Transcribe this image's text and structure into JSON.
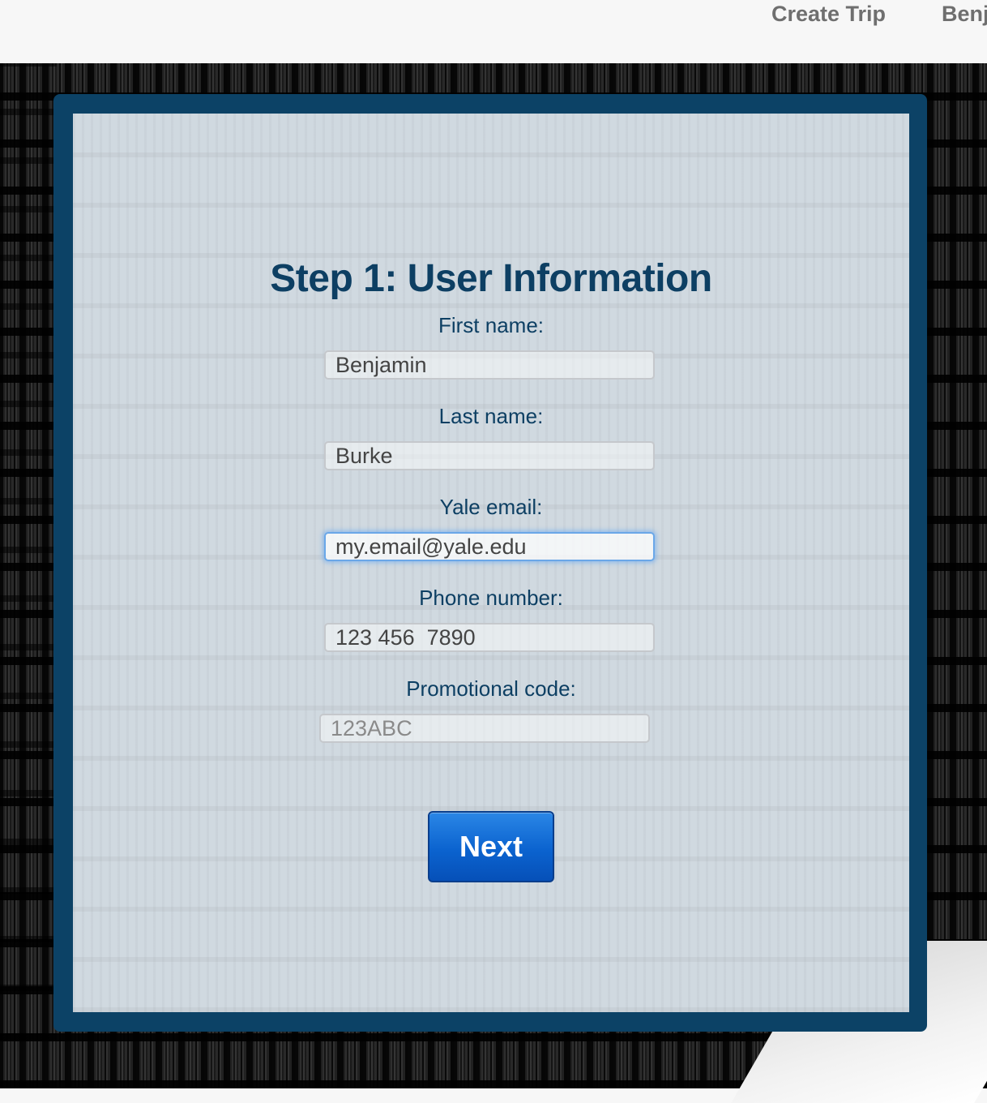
{
  "nav": {
    "create_trip": "Create Trip",
    "user": "Benj"
  },
  "form": {
    "title": "Step 1: User Information",
    "first_name": {
      "label": "First name:",
      "value": "Benjamin"
    },
    "last_name": {
      "label": "Last name:",
      "value": "Burke"
    },
    "email": {
      "label": "Yale email:",
      "value": "my.email@yale.edu"
    },
    "phone": {
      "label": "Phone number:",
      "value": "123 456  7890"
    },
    "promo": {
      "label": "Promotional code:",
      "placeholder": "123ABC"
    },
    "next_label": "Next"
  },
  "colors": {
    "frame": "#0c4266",
    "title": "#0d3f63",
    "button": "#0b63cf",
    "nav_text": "#6f6f6f"
  }
}
